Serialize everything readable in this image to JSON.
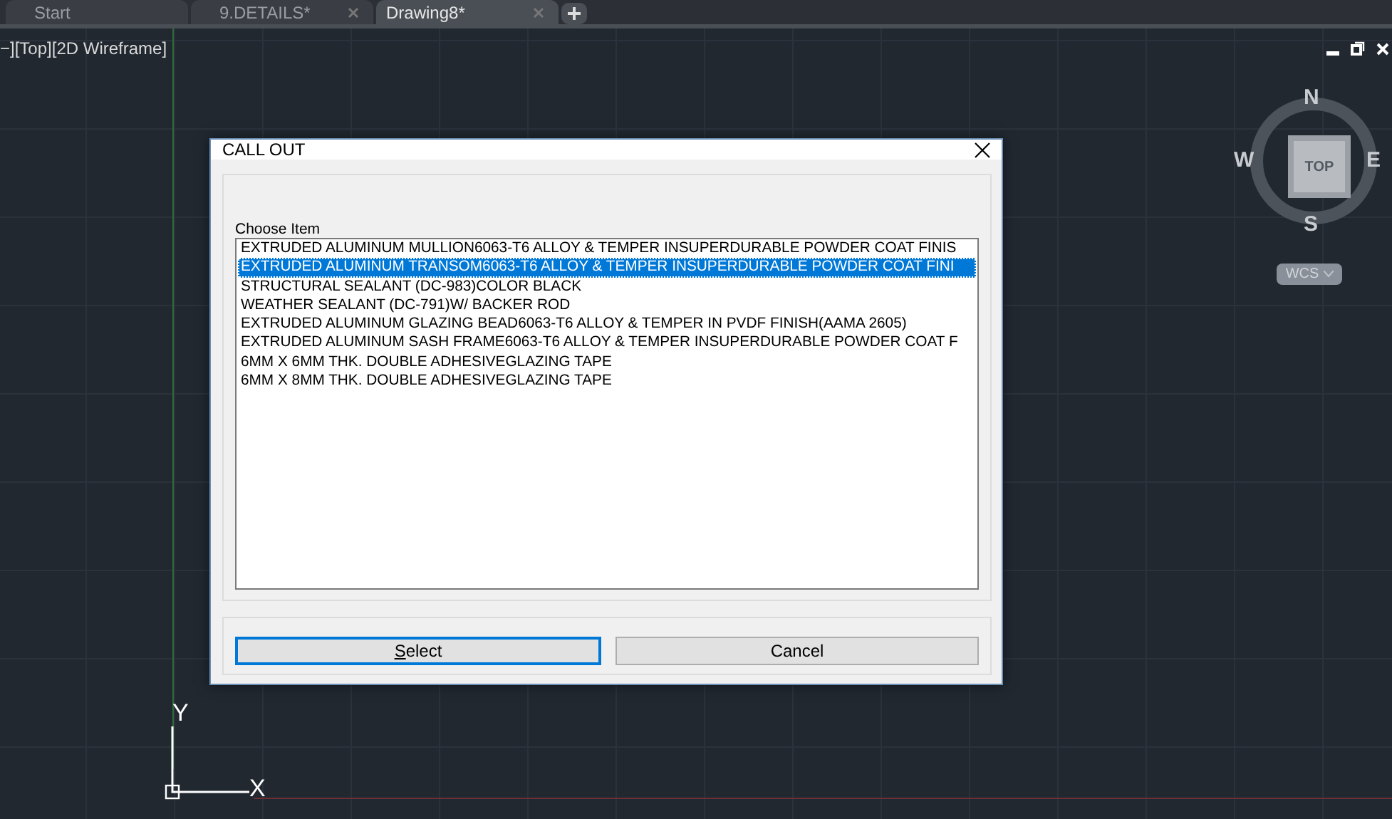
{
  "tabs": [
    {
      "label": "Start",
      "closable": false,
      "selected": false
    },
    {
      "label": "9.DETAILS*",
      "closable": true,
      "selected": false
    },
    {
      "label": "Drawing8*",
      "closable": true,
      "selected": true
    }
  ],
  "viewport": {
    "label": "−][Top][2D Wireframe]"
  },
  "viewcube": {
    "north": "N",
    "south": "S",
    "east": "E",
    "west": "W",
    "face": "TOP",
    "ucs_menu": "WCS"
  },
  "ucs_axes": {
    "x": "X",
    "y": "Y"
  },
  "dialog": {
    "title": "CALL OUT",
    "list_label": "Choose Item",
    "items": [
      {
        "label": "EXTRUDED ALUMINUM MULLION6063-T6 ALLOY & TEMPER INSUPERDURABLE POWDER COAT FINIS",
        "selected": false
      },
      {
        "label": "EXTRUDED ALUMINUM TRANSOM6063-T6 ALLOY & TEMPER INSUPERDURABLE POWDER COAT FINI",
        "selected": true
      },
      {
        "label": "STRUCTURAL SEALANT (DC-983)COLOR BLACK",
        "selected": false
      },
      {
        "label": "WEATHER SEALANT (DC-791)W/ BACKER ROD",
        "selected": false
      },
      {
        "label": "EXTRUDED ALUMINUM GLAZING BEAD6063-T6 ALLOY & TEMPER IN PVDF FINISH(AAMA 2605)",
        "selected": false
      },
      {
        "label": "EXTRUDED ALUMINUM SASH FRAME6063-T6 ALLOY & TEMPER INSUPERDURABLE POWDER COAT F",
        "selected": false
      },
      {
        "label": "6MM X 6MM THK. DOUBLE ADHESIVEGLAZING TAPE",
        "selected": false
      },
      {
        "label": "6MM X 8MM THK. DOUBLE ADHESIVEGLAZING TAPE",
        "selected": false
      }
    ],
    "buttons": [
      {
        "label": "Select",
        "default": true
      },
      {
        "label": "Cancel",
        "default": false
      }
    ]
  }
}
